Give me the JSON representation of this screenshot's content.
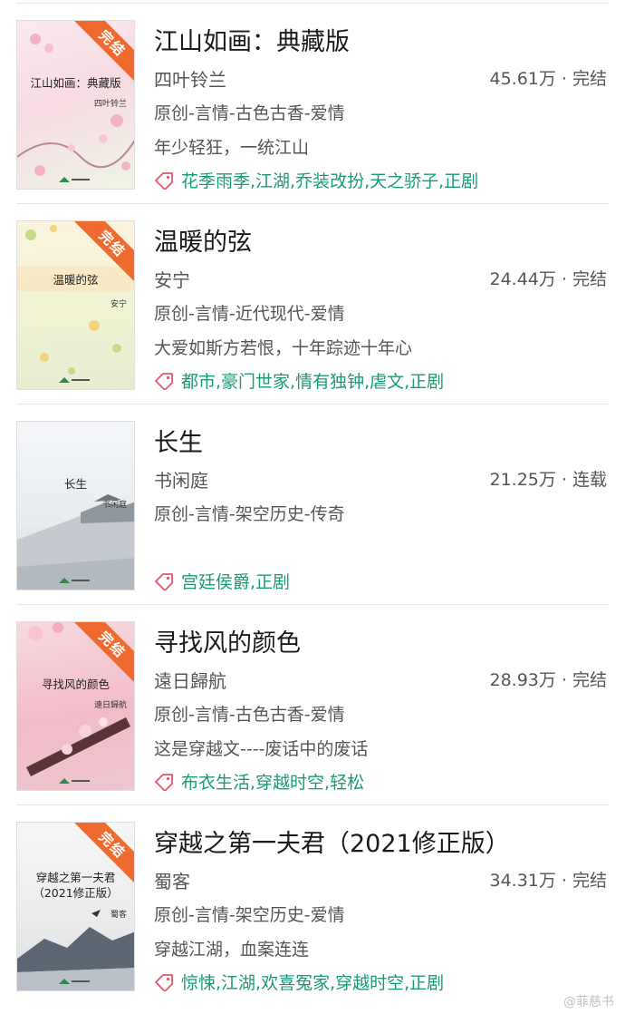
{
  "books": [
    {
      "title": "江山如画：典藏版",
      "author": "四叶铃兰",
      "stats": "45.61万 · 完结",
      "genre": "原创-言情-古色古香-爱情",
      "desc": "年少轻狂，一统江山",
      "tags": "花季雨季,江湖,乔装改扮,天之骄子,正剧",
      "cover_title": "江山如画：典藏版",
      "cover_author": "四叶铃兰",
      "ribbon": "完结",
      "cover_colors": [
        "#fbe9ee",
        "#f6d2de",
        "#e7f0dc"
      ]
    },
    {
      "title": "温暖的弦",
      "author": "安宁",
      "stats": "24.44万 · 完结",
      "genre": "原创-言情-近代现代-爱情",
      "desc": "大爱如斯方若恨，十年踪迹十年心",
      "tags": "都市,豪门世家,情有独钟,虐文,正剧",
      "cover_title": "温暖的弦",
      "cover_author": "安宁",
      "ribbon": "完结",
      "cover_colors": [
        "#fbf3dd",
        "#eef2cc",
        "#e5eccc"
      ]
    },
    {
      "title": "长生",
      "author": "书闲庭",
      "stats": "21.25万 · 连载",
      "genre": "原创-言情-架空历史-传奇",
      "desc": "",
      "tags": "宫廷侯爵,正剧",
      "cover_title": "长生",
      "cover_author": "书闲庭",
      "ribbon": "",
      "cover_colors": [
        "#f1f4f7",
        "#dfe4e8",
        "#bfc6cc"
      ]
    },
    {
      "title": "寻找风的颜色",
      "author": "遠日歸航",
      "stats": "28.93万 · 完结",
      "genre": "原创-言情-古色古香-爱情",
      "desc": "这是穿越文----废话中的废话",
      "tags": "布衣生活,穿越时空,轻松",
      "cover_title": "寻找风的颜色",
      "cover_author": "遠日歸航",
      "ribbon": "完结",
      "cover_colors": [
        "#f6d3da",
        "#f0b8c4",
        "#efc6cf"
      ]
    },
    {
      "title": "穿越之第一夫君（2021修正版）",
      "author": "蜀客",
      "stats": "34.31万 · 完结",
      "genre": "原创-言情-架空历史-爱情",
      "desc": "穿越江湖，血案连连",
      "tags": "惊悚,江湖,欢喜冤家,穿越时空,正剧",
      "cover_title": "穿越之第一夫君\n（2021修正版）",
      "cover_author": "蜀客",
      "ribbon": "完结",
      "cover_colors": [
        "#f4f4f4",
        "#e6e6e6",
        "#6f7884"
      ]
    }
  ],
  "watermark": "@菲慈书",
  "colors": {
    "tag": "#1a9a78",
    "ribbon": "#ef6a2e",
    "tag_icon": "#e8556a"
  },
  "icons": {
    "tag": "price-tag-icon"
  }
}
